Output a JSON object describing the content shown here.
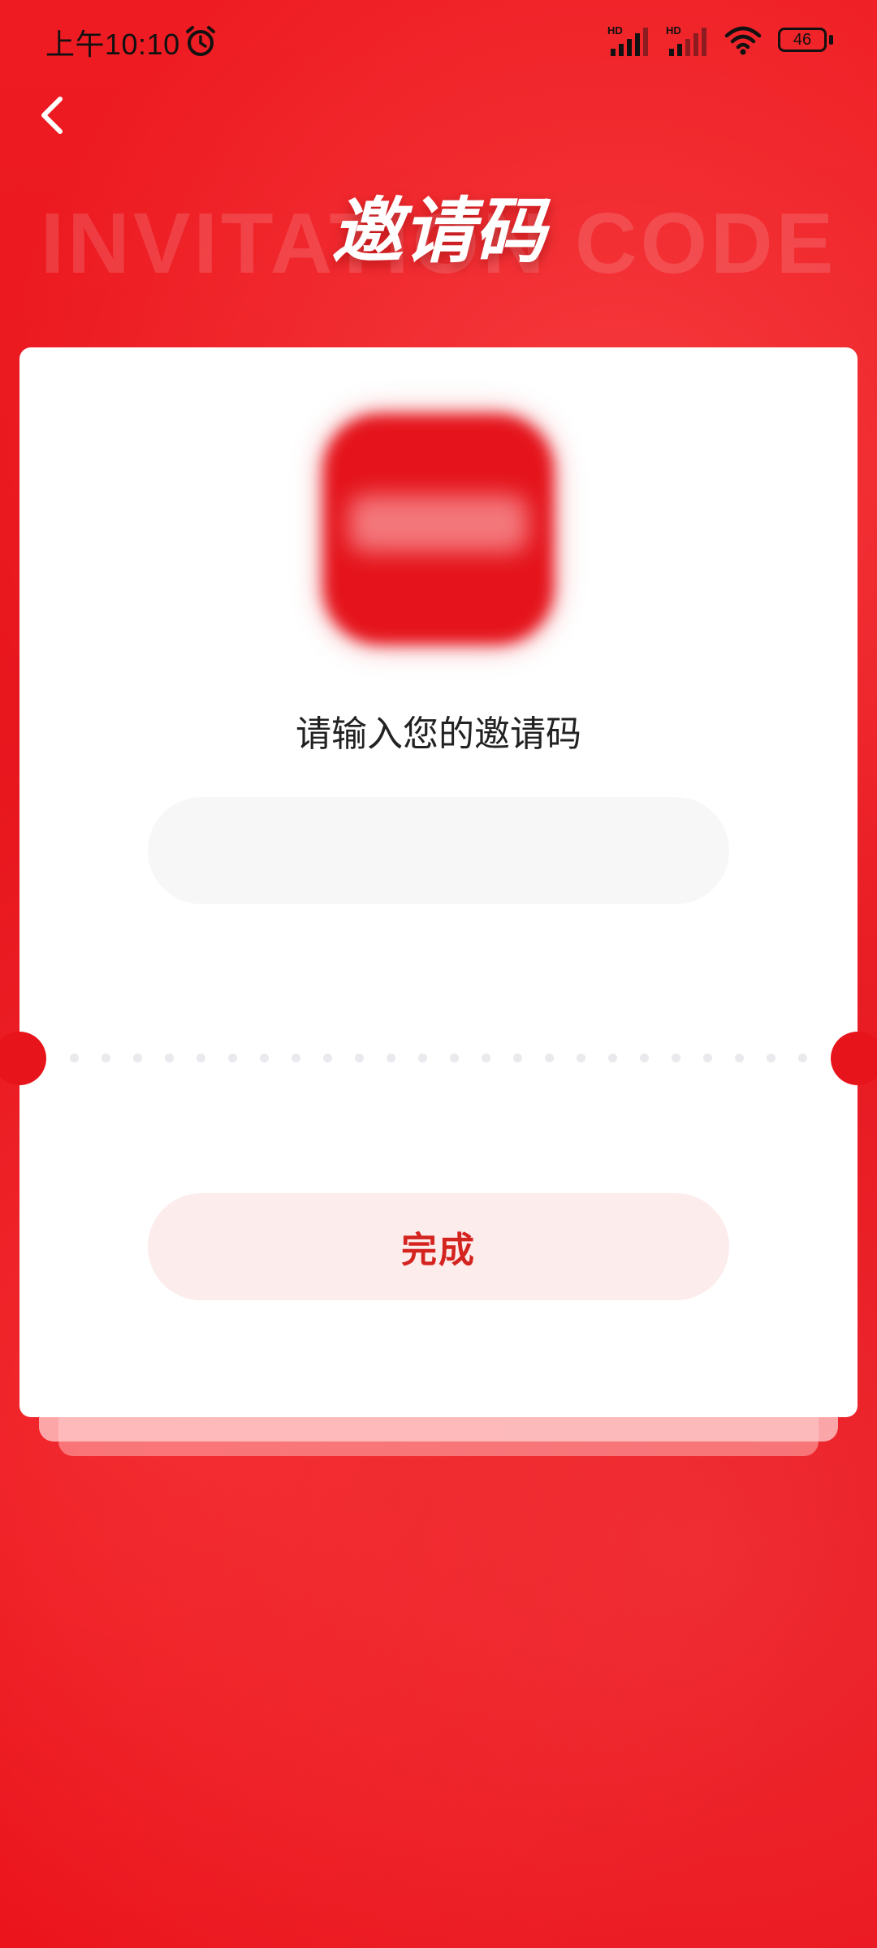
{
  "status_bar": {
    "time": "上午10:10",
    "signal_1_label": "HD",
    "signal_2_label": "HD",
    "battery_level": "46",
    "icons": [
      "alarm-icon",
      "signal-icon",
      "signal-icon",
      "wifi-icon",
      "battery-icon"
    ]
  },
  "header": {
    "back_icon": "chevron-left-icon",
    "title": "邀请码",
    "watermark": "INVITATION CODE"
  },
  "card": {
    "logo": "app-logo",
    "prompt": "请输入您的邀请码",
    "input_value": "",
    "input_placeholder": "",
    "done_label": "完成"
  },
  "colors": {
    "background": "#e8141b",
    "card": "#ffffff",
    "accent": "#d4241f",
    "input_bg": "#f7f7f7",
    "button_bg": "#fdecec"
  }
}
